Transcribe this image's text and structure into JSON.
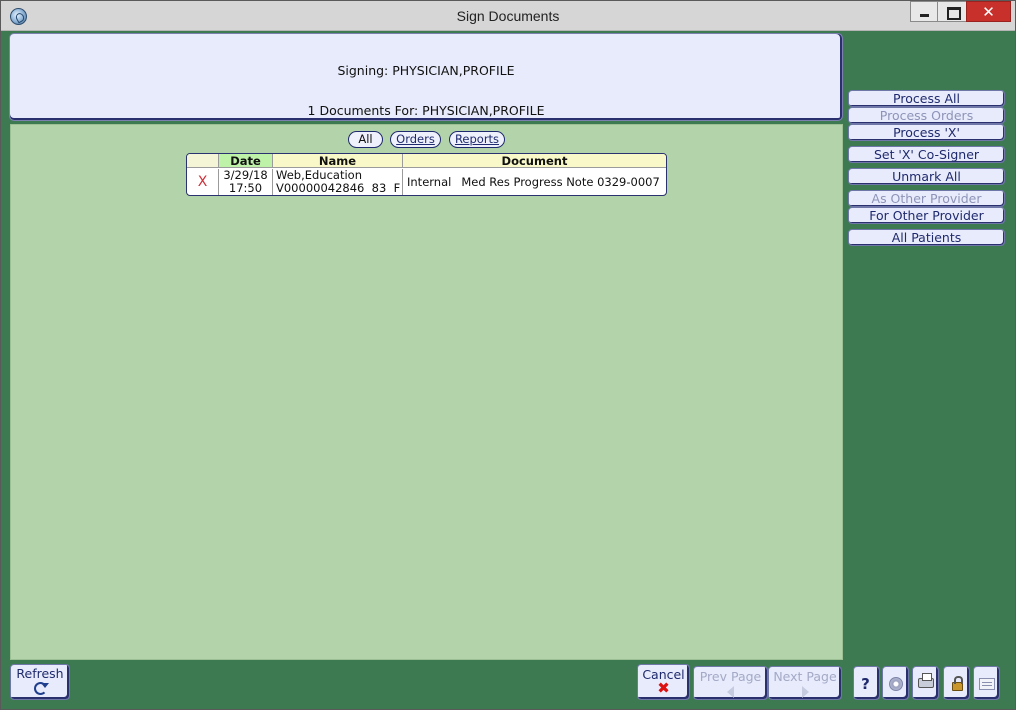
{
  "window": {
    "title": "Sign Documents",
    "close_glyph": "✕"
  },
  "header": {
    "signing_label": "Signing: PHYSICIAN,PROFILE",
    "documents_for_label": "1 Documents For: PHYSICIAN,PROFILE"
  },
  "filters": {
    "all": "All",
    "orders": "Orders",
    "reports": "Reports",
    "selected": "All"
  },
  "table": {
    "columns": [
      "",
      "Date",
      "Name",
      "Document"
    ],
    "rows": [
      {
        "mark": "X",
        "date": "3/29/18",
        "time": "17:50",
        "patient_name": "Web,Education",
        "patient_id": "V00000042846  83  F",
        "doc_type": "Internal",
        "doc_title": "Med Res Progress Note 0329-0007"
      }
    ]
  },
  "side_buttons": {
    "process_all": "Process All",
    "process_orders": "Process Orders",
    "process_x": "Process 'X'",
    "set_x_cosigner": "Set 'X' Co-Signer",
    "unmark_all": "Unmark All",
    "as_other_provider": "As Other Provider",
    "for_other_provider": "For Other Provider",
    "all_patients": "All Patients"
  },
  "bottom_buttons": {
    "refresh": "Refresh",
    "cancel": "Cancel",
    "prev_page": "Prev Page",
    "next_page": "Next Page"
  },
  "icons": {
    "cancel_glyph": "✖",
    "help_glyph": "?"
  },
  "colors": {
    "workspace_green": "#3d7a52",
    "content_green": "#b3d3aa",
    "button_face": "#e8ebfb",
    "button_text": "#1f2a6e",
    "mark_red": "#d0303a"
  }
}
